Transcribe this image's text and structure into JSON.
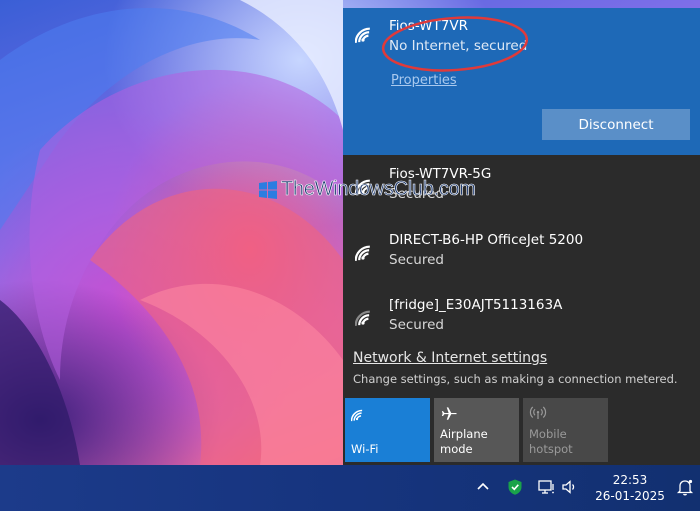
{
  "watermark": {
    "text": "TheWindowsClub.com"
  },
  "active_network": {
    "name": "Fios-WT7VR",
    "status": "No Internet, secured",
    "properties_label": "Properties",
    "disconnect_label": "Disconnect",
    "icon": "wifi-icon"
  },
  "networks": [
    {
      "name": "Fios-WT7VR-5G",
      "status": "Secured",
      "icon": "wifi-icon"
    },
    {
      "name": "DIRECT-B6-HP OfficeJet 5200",
      "status": "Secured",
      "icon": "wifi-icon"
    },
    {
      "name": "[fridge]_E30AJT5113163A",
      "status": "Secured",
      "icon": "wifi-icon"
    }
  ],
  "settings": {
    "link": "Network & Internet settings",
    "description": "Change settings, such as making a connection metered."
  },
  "quick_actions": [
    {
      "label": "Wi-Fi",
      "icon": "wifi-icon",
      "state": "on"
    },
    {
      "label": "Airplane mode",
      "icon": "airplane-icon",
      "state": "off"
    },
    {
      "label": "Mobile\nhotspot",
      "icon": "hotspot-icon",
      "state": "disabled"
    }
  ],
  "taskbar": {
    "time": "22:53",
    "date": "26-01-2025",
    "icons": [
      "chevron-up-icon",
      "defender-shield-icon",
      "network-icon",
      "volume-icon",
      "notification-icon"
    ]
  },
  "colors": {
    "active_bg": "#1e69b7",
    "flyout_bg": "#2b2b2b",
    "disconnect_bg": "#5a8fc8",
    "wifi_tile_bg": "#1a7fd6",
    "annotation_red": "#e03a3a"
  }
}
